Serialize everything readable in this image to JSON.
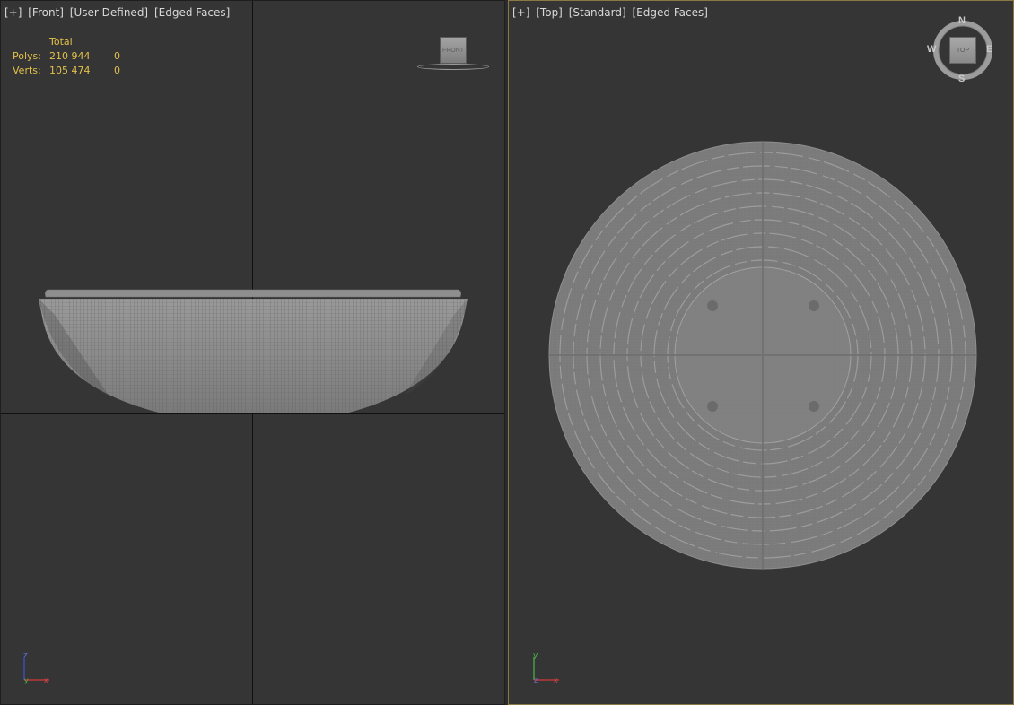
{
  "front_viewport": {
    "label": {
      "plus": "[+]",
      "view": "[Front]",
      "shading": "[User Defined]",
      "mode": "[Edged Faces]"
    },
    "stats": {
      "header": "Total",
      "rows": [
        {
          "label": "Polys:",
          "value": "210 944",
          "selected": "0"
        },
        {
          "label": "Verts:",
          "value": "105 474",
          "selected": "0"
        }
      ]
    },
    "viewcube_face": "FRONT",
    "axis": {
      "up": "z",
      "right": "x",
      "center": "y"
    }
  },
  "top_viewport": {
    "label": {
      "plus": "[+]",
      "view": "[Top]",
      "shading": "[Standard]",
      "mode": "[Edged Faces]"
    },
    "viewcube_face": "TOP",
    "compass": {
      "n": "N",
      "s": "S",
      "e": "E",
      "w": "W"
    },
    "axis": {
      "up": "y",
      "right": "x",
      "center": "z"
    }
  },
  "colors": {
    "active_border": "#8a7744",
    "stats_text": "#e2c14a",
    "viewport_bg": "#353535"
  }
}
